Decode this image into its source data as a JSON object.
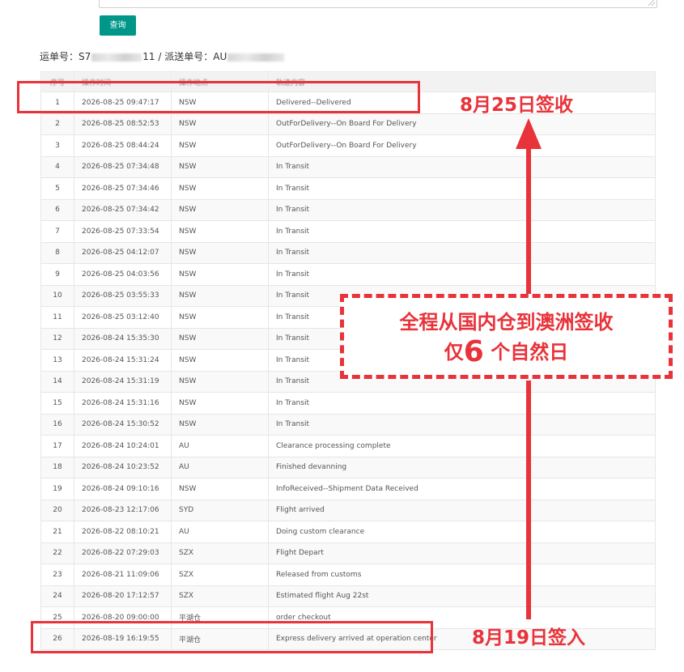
{
  "query_button": {
    "label": "查询"
  },
  "waybill": {
    "label": "运单号：",
    "prefix": "S7",
    "suffix": "11",
    "separator": " / ",
    "dispatch_label": "派送单号：",
    "dispatch_prefix": "AU"
  },
  "table": {
    "headers": [
      "序号",
      "操作时间",
      "操作地点",
      "轨迹内容"
    ],
    "rows": [
      [
        "1",
        "2026-08-25 09:47:17",
        "NSW",
        "Delivered--Delivered"
      ],
      [
        "2",
        "2026-08-25 08:52:53",
        "NSW",
        "OutForDelivery--On Board For Delivery"
      ],
      [
        "3",
        "2026-08-25 08:44:24",
        "NSW",
        "OutForDelivery--On Board For Delivery"
      ],
      [
        "4",
        "2026-08-25 07:34:48",
        "NSW",
        "In Transit"
      ],
      [
        "5",
        "2026-08-25 07:34:46",
        "NSW",
        "In Transit"
      ],
      [
        "6",
        "2026-08-25 07:34:42",
        "NSW",
        "In Transit"
      ],
      [
        "7",
        "2026-08-25 07:33:54",
        "NSW",
        "In Transit"
      ],
      [
        "8",
        "2026-08-25 04:12:07",
        "NSW",
        "In Transit"
      ],
      [
        "9",
        "2026-08-25 04:03:56",
        "NSW",
        "In Transit"
      ],
      [
        "10",
        "2026-08-25 03:55:33",
        "NSW",
        "In Transit"
      ],
      [
        "11",
        "2026-08-25 03:12:40",
        "NSW",
        "In Transit"
      ],
      [
        "12",
        "2026-08-24 15:35:30",
        "NSW",
        "In Transit"
      ],
      [
        "13",
        "2026-08-24 15:31:24",
        "NSW",
        "In Transit"
      ],
      [
        "14",
        "2026-08-24 15:31:19",
        "NSW",
        "In Transit"
      ],
      [
        "15",
        "2026-08-24 15:31:16",
        "NSW",
        "In Transit"
      ],
      [
        "16",
        "2026-08-24 15:30:52",
        "NSW",
        "In Transit"
      ],
      [
        "17",
        "2026-08-24 10:24:01",
        "AU",
        "Clearance processing complete"
      ],
      [
        "18",
        "2026-08-24 10:23:52",
        "AU",
        "Finished devanning"
      ],
      [
        "19",
        "2026-08-24 09:10:16",
        "NSW",
        "InfoReceived--Shipment Data Received"
      ],
      [
        "20",
        "2026-08-23 12:17:06",
        "SYD",
        "Flight arrived"
      ],
      [
        "21",
        "2026-08-22 08:10:21",
        "AU",
        "Doing custom clearance"
      ],
      [
        "22",
        "2026-08-22 07:29:03",
        "SZX",
        "Flight Depart"
      ],
      [
        "23",
        "2026-08-21 11:09:06",
        "SZX",
        "Released from customs"
      ],
      [
        "24",
        "2026-08-20 17:12:57",
        "SZX",
        "Estimated flight Aug 22st"
      ],
      [
        "25",
        "2026-08-20 09:00:00",
        "平湖仓",
        "order checkout"
      ],
      [
        "26",
        "2026-08-19 16:19:55",
        "平湖仓",
        "Express delivery arrived at operation center"
      ]
    ]
  },
  "annotations": {
    "delivered_label": "8月25日签收",
    "received_label": "8月19日签入",
    "note_line1": "全程从国内仓到澳洲签收",
    "note_line2_pre": "仅",
    "note_line2_num": "6",
    "note_line2_post": " 个自然日",
    "accent_color": "#e8333a"
  },
  "colors": {
    "button": "#009688",
    "annotation": "#e8333a"
  }
}
